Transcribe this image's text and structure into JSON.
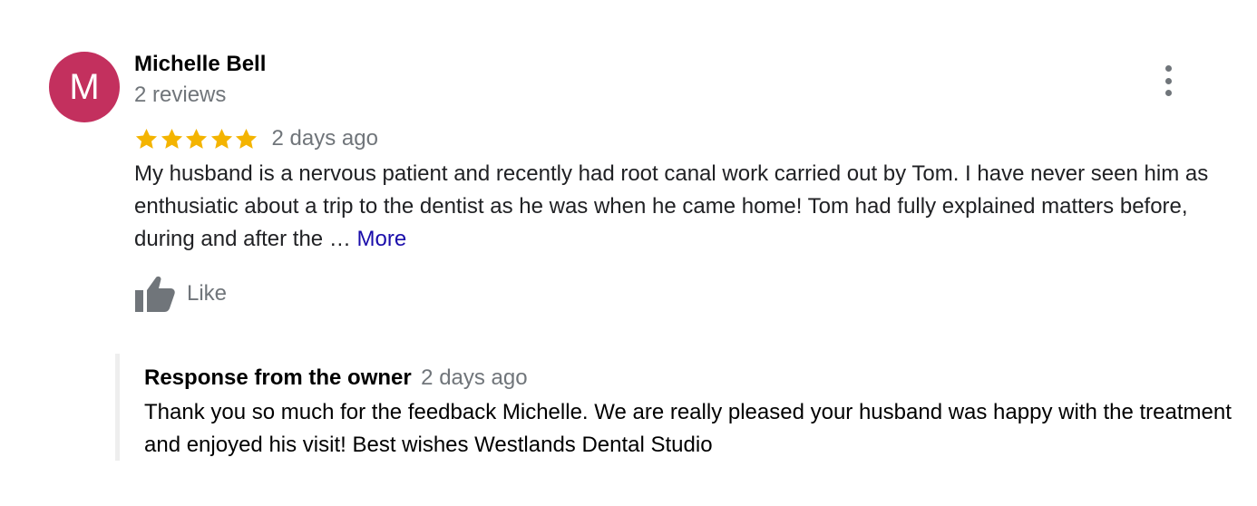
{
  "review": {
    "avatar_letter": "M",
    "avatar_color": "#c3305e",
    "reviewer_name": "Michelle Bell",
    "review_count": "2 reviews",
    "rating": 5,
    "rating_max": 5,
    "star_color": "#f4b400",
    "time": "2 days ago",
    "text": "My husband is a nervous patient and recently had root canal work carried out by Tom. I have never seen him as enthusiatic about a trip to the dentist as he was when he came home! Tom had fully explained matters before, during and after the … ",
    "more_label": "More",
    "like_label": "Like",
    "menu_icon": "more-vert-icon"
  },
  "owner_response": {
    "title": "Response from the owner",
    "time": "2 days ago",
    "text": "Thank you so much for the feedback Michelle. We are really pleased your husband was happy with the treatment and enjoyed his visit! Best wishes Westlands Dental Studio"
  }
}
